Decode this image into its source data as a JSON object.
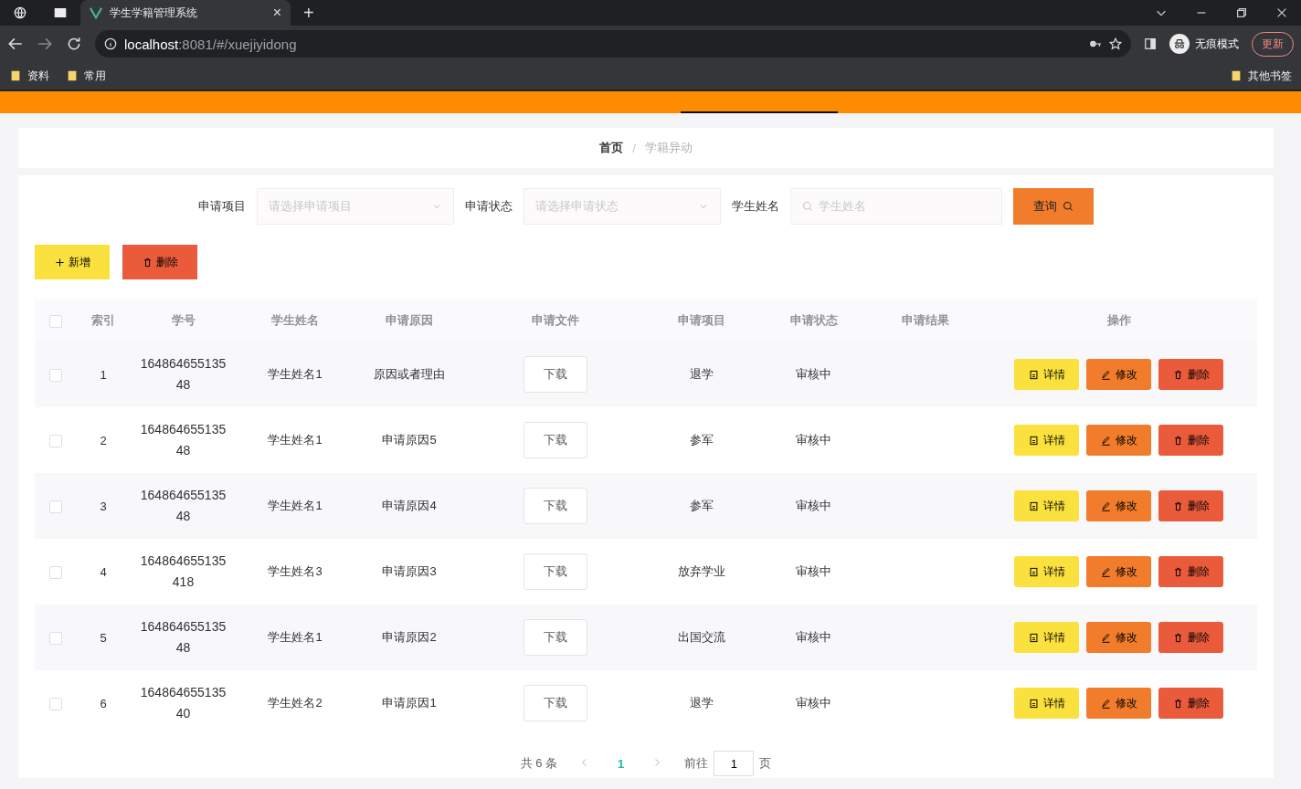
{
  "browser": {
    "tab_title": "学生学籍管理系统",
    "tab_close": "×",
    "new_tab": "+",
    "url_host": "localhost",
    "url_rest": ":8081/#/xuejiyidong",
    "profile_label": "无痕模式",
    "update_button": "更新",
    "bookmarks": [
      "资料",
      "常用"
    ],
    "other_bookmarks": "其他书签"
  },
  "breadcrumb_separator": "/",
  "breadcrumb": [
    {
      "label": "首页",
      "current": false
    },
    {
      "label": "学籍异动",
      "current": true
    }
  ],
  "filters": [
    {
      "kind": "select",
      "label": "申请项目",
      "placeholder": "请选择申请项目"
    },
    {
      "kind": "select",
      "label": "申请状态",
      "placeholder": "请选择申请状态"
    },
    {
      "kind": "search",
      "label": "学生姓名",
      "placeholder": "学生姓名"
    }
  ],
  "query_button": "查询",
  "actions": {
    "add": "新增",
    "delete": "删除"
  },
  "table": {
    "select_all_checked": false,
    "columns": [
      "索引",
      "学号",
      "学生姓名",
      "申请原因",
      "申请文件",
      "申请项目",
      "申请状态",
      "申请结果",
      "操作"
    ],
    "rows": [
      {
        "index": "1",
        "student_id": "16486465513548",
        "name": "学生姓名1",
        "reason": "原因或者理由",
        "file": "下载",
        "project": "退学",
        "status": "审核中",
        "checked": false
      },
      {
        "index": "2",
        "student_id": "16486465513548",
        "name": "学生姓名1",
        "reason": "申请原因5",
        "file": "下载",
        "project": "参军",
        "status": "审核中",
        "checked": false
      },
      {
        "index": "3",
        "student_id": "16486465513548",
        "name": "学生姓名1",
        "reason": "申请原因4",
        "file": "下载",
        "project": "参军",
        "status": "审核中",
        "checked": false
      },
      {
        "index": "4",
        "student_id": "164864655135418",
        "name": "学生姓名3",
        "reason": "申请原因3",
        "file": "下载",
        "project": "放弃学业",
        "status": "审核中",
        "checked": false
      },
      {
        "index": "5",
        "student_id": "16486465513548",
        "name": "学生姓名1",
        "reason": "申请原因2",
        "file": "下载",
        "project": "出国交流",
        "status": "审核中",
        "checked": false
      },
      {
        "index": "6",
        "student_id": "16486465513540",
        "name": "学生姓名2",
        "reason": "申请原因1",
        "file": "下载",
        "project": "退学",
        "status": "审核中",
        "checked": false
      }
    ],
    "row_buttons": [
      [
        "详情",
        "修改",
        "删除"
      ],
      [
        "详情",
        "修改",
        "删除"
      ],
      [
        "详情",
        "修改",
        "删除"
      ],
      [
        "详情",
        "修改",
        "删除"
      ],
      [
        "详情",
        "修改",
        "删除"
      ],
      [
        "详情",
        "修改",
        "删除"
      ]
    ]
  },
  "pagination": {
    "total": "共 6 条",
    "pages": [
      {
        "label": "1",
        "selected": true
      }
    ],
    "goto_label": "前往",
    "goto_value": "1",
    "page_suffix": "页"
  }
}
